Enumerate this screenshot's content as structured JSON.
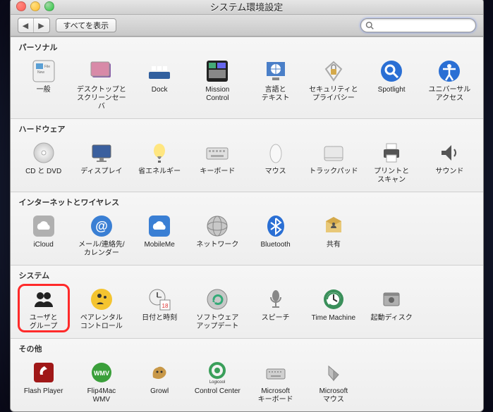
{
  "window": {
    "title": "システム環境設定"
  },
  "toolbar": {
    "show_all": "すべてを表示"
  },
  "search": {
    "placeholder": ""
  },
  "sections": {
    "personal": {
      "title": "パーソナル",
      "items": {
        "general": "一般",
        "desktop": "デスクトップと\nスクリーンセーバ",
        "dock": "Dock",
        "mission_control": "Mission\nControl",
        "language_text": "言語と\nテキスト",
        "security": "セキュリティと\nプライバシー",
        "spotlight": "Spotlight",
        "universal_access": "ユニバーサル\nアクセス"
      }
    },
    "hardware": {
      "title": "ハードウェア",
      "items": {
        "cd_dvd": "CD と DVD",
        "displays": "ディスプレイ",
        "energy": "省エネルギー",
        "keyboard": "キーボード",
        "mouse": "マウス",
        "trackpad": "トラックパッド",
        "print_scan": "プリントと\nスキャン",
        "sound": "サウンド"
      }
    },
    "internet": {
      "title": "インターネットとワイヤレス",
      "items": {
        "icloud": "iCloud",
        "mail": "メール/連絡先/\nカレンダー",
        "mobileme": "MobileMe",
        "network": "ネットワーク",
        "bluetooth": "Bluetooth",
        "sharing": "共有"
      }
    },
    "system": {
      "title": "システム",
      "items": {
        "users": "ユーザと\nグループ",
        "parental": "ペアレンタル\nコントロール",
        "datetime": "日付と時刻",
        "software_update": "ソフトウェア\nアップデート",
        "speech": "スピーチ",
        "timemachine": "Time Machine",
        "startup": "起動ディスク"
      }
    },
    "other": {
      "title": "その他",
      "items": {
        "flash": "Flash Player",
        "flip4mac": "Flip4Mac\nWMV",
        "growl": "Growl",
        "logicool": "Control Center",
        "ms_keyboard": "Microsoft\nキーボード",
        "ms_mouse": "Microsoft\nマウス"
      }
    }
  },
  "highlighted_item": "users"
}
